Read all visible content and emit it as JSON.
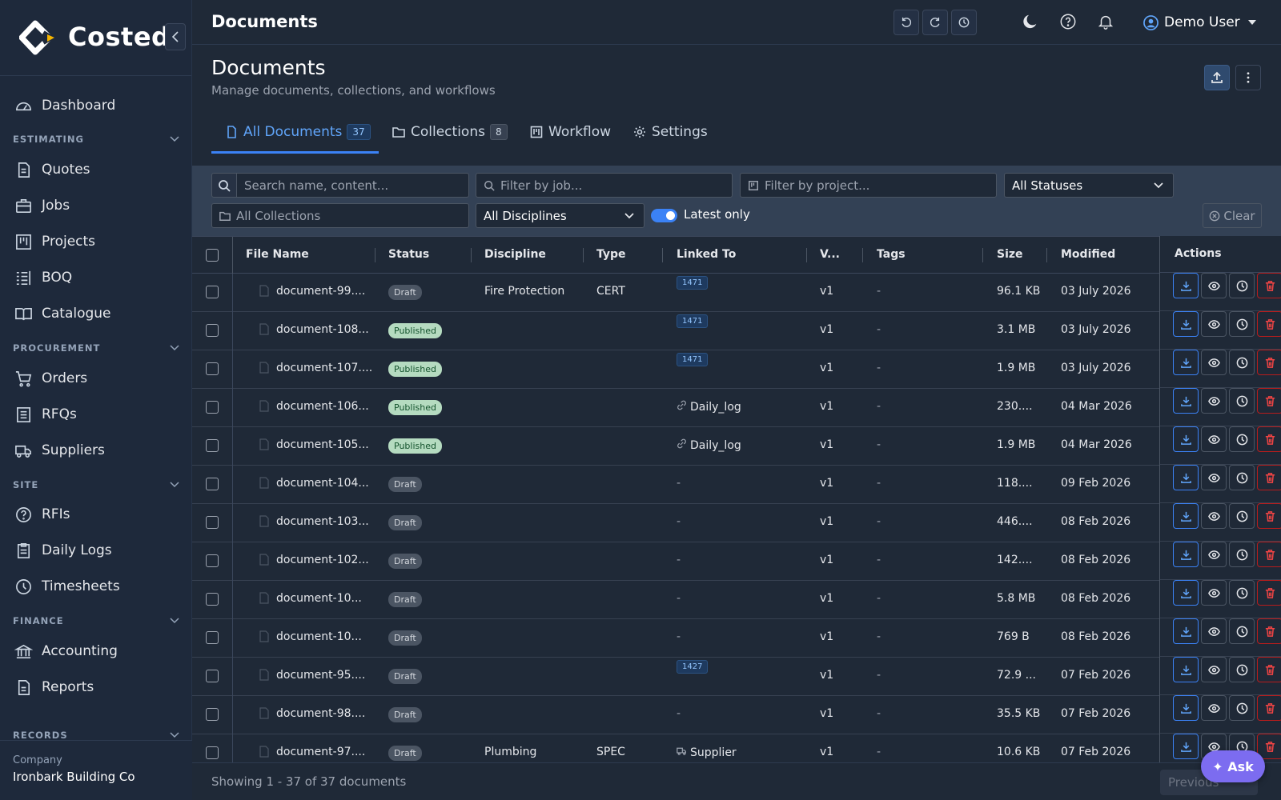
{
  "app": {
    "name": "Costed",
    "brand_color": "#f5b400"
  },
  "topbar": {
    "title": "Documents",
    "user": "Demo User"
  },
  "sidebar": {
    "dashboard": "Dashboard",
    "sections": [
      {
        "label": "ESTIMATING",
        "items": [
          "Quotes",
          "Jobs",
          "Projects",
          "BOQ",
          "Catalogue"
        ]
      },
      {
        "label": "PROCUREMENT",
        "items": [
          "Orders",
          "RFQs",
          "Suppliers"
        ]
      },
      {
        "label": "SITE",
        "items": [
          "RFIs",
          "Daily Logs",
          "Timesheets"
        ]
      },
      {
        "label": "FINANCE",
        "items": [
          "Accounting",
          "Reports"
        ]
      },
      {
        "label": "RECORDS",
        "items": []
      }
    ],
    "company_label": "Company",
    "company_name": "Ironbark Building Co"
  },
  "page": {
    "title": "Documents",
    "subtitle": "Manage documents, collections, and workflows"
  },
  "tabs": [
    {
      "label": "All Documents",
      "count": "37",
      "icon": "file-icon",
      "active": true
    },
    {
      "label": "Collections",
      "count": "8",
      "icon": "folder-icon",
      "active": false
    },
    {
      "label": "Workflow",
      "count": "",
      "icon": "kanban-icon",
      "active": false
    },
    {
      "label": "Settings",
      "count": "",
      "icon": "gear-icon",
      "active": false
    }
  ],
  "filters": {
    "search_placeholder": "Search name, content...",
    "job_placeholder": "Filter by job...",
    "project_placeholder": "Filter by project...",
    "status_value": "All Statuses",
    "collections_placeholder": "All Collections",
    "discipline_value": "All Disciplines",
    "latest_only_label": "Latest only",
    "latest_only": true,
    "clear_label": "Clear"
  },
  "table": {
    "columns": [
      "File Name",
      "Status",
      "Discipline",
      "Type",
      "Linked To",
      "V...",
      "Tags",
      "Size",
      "Modified",
      "Actions"
    ],
    "rows": [
      {
        "name": "document-99....",
        "status": "Draft",
        "discipline": "Fire Protection",
        "type": "CERT",
        "job": "1471",
        "linked": "",
        "linked_icon": "",
        "version": "v1",
        "tags": "-",
        "size": "96.1 KB",
        "modified": "03 July 2026"
      },
      {
        "name": "document-108...",
        "status": "Published",
        "discipline": "",
        "type": "",
        "job": "1471",
        "linked": "",
        "linked_icon": "",
        "version": "v1",
        "tags": "-",
        "size": "3.1 MB",
        "modified": "03 July 2026"
      },
      {
        "name": "document-107....",
        "status": "Published",
        "discipline": "",
        "type": "",
        "job": "1471",
        "linked": "",
        "linked_icon": "",
        "version": "v1",
        "tags": "-",
        "size": "1.9 MB",
        "modified": "03 July 2026"
      },
      {
        "name": "document-106...",
        "status": "Published",
        "discipline": "",
        "type": "",
        "job": "",
        "linked": "Daily_log",
        "linked_icon": "link-icon",
        "version": "v1",
        "tags": "-",
        "size": "230....",
        "modified": "04 Mar 2026"
      },
      {
        "name": "document-105...",
        "status": "Published",
        "discipline": "",
        "type": "",
        "job": "",
        "linked": "Daily_log",
        "linked_icon": "link-icon",
        "version": "v1",
        "tags": "-",
        "size": "1.9 MB",
        "modified": "04 Mar 2026"
      },
      {
        "name": "document-104...",
        "status": "Draft",
        "discipline": "",
        "type": "",
        "job": "",
        "linked": "-",
        "linked_icon": "",
        "version": "v1",
        "tags": "-",
        "size": "118....",
        "modified": "09 Feb 2026"
      },
      {
        "name": "document-103...",
        "status": "Draft",
        "discipline": "",
        "type": "",
        "job": "",
        "linked": "-",
        "linked_icon": "",
        "version": "v1",
        "tags": "-",
        "size": "446....",
        "modified": "08 Feb 2026"
      },
      {
        "name": "document-102...",
        "status": "Draft",
        "discipline": "",
        "type": "",
        "job": "",
        "linked": "-",
        "linked_icon": "",
        "version": "v1",
        "tags": "-",
        "size": "142....",
        "modified": "08 Feb 2026"
      },
      {
        "name": "document-10...",
        "status": "Draft",
        "discipline": "",
        "type": "",
        "job": "",
        "linked": "-",
        "linked_icon": "",
        "version": "v1",
        "tags": "-",
        "size": "5.8 MB",
        "modified": "08 Feb 2026"
      },
      {
        "name": "document-10...",
        "status": "Draft",
        "discipline": "",
        "type": "",
        "job": "",
        "linked": "-",
        "linked_icon": "",
        "version": "v1",
        "tags": "-",
        "size": "769 B",
        "modified": "08 Feb 2026"
      },
      {
        "name": "document-95....",
        "status": "Draft",
        "discipline": "",
        "type": "",
        "job": "1427",
        "linked": "",
        "linked_icon": "",
        "version": "v1",
        "tags": "-",
        "size": "72.9 ...",
        "modified": "07 Feb 2026"
      },
      {
        "name": "document-98....",
        "status": "Draft",
        "discipline": "",
        "type": "",
        "job": "",
        "linked": "-",
        "linked_icon": "",
        "version": "v1",
        "tags": "-",
        "size": "35.5 KB",
        "modified": "07 Feb 2026"
      },
      {
        "name": "document-97....",
        "status": "Draft",
        "discipline": "Plumbing",
        "type": "SPEC",
        "job": "",
        "linked": "Supplier",
        "linked_icon": "truck-icon",
        "version": "v1",
        "tags": "-",
        "size": "10.6 KB",
        "modified": "07 Feb 2026"
      }
    ]
  },
  "footer": {
    "showing": "Showing 1 - 37 of 37 documents",
    "previous_label": "Previous"
  },
  "ask": {
    "label": "✦ Ask"
  }
}
